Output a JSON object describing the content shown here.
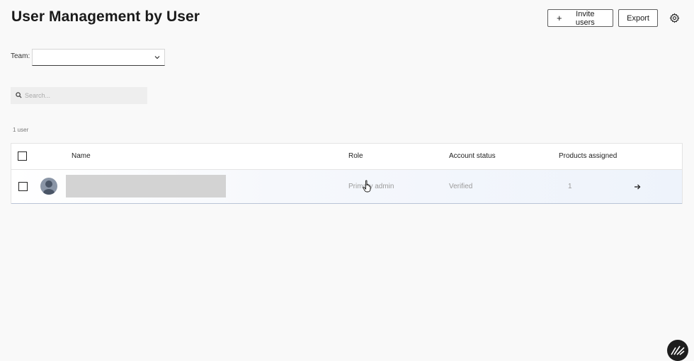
{
  "page": {
    "title": "User Management by User"
  },
  "header": {
    "invite_label": "Invite users",
    "invite_icon": "plus-icon",
    "export_label": "Export",
    "settings_icon": "gear-icon"
  },
  "filters": {
    "team_label": "Team:",
    "team_value": "",
    "search_placeholder": "Search..."
  },
  "summary": {
    "user_count": "1 user"
  },
  "table": {
    "columns": [
      "Name",
      "Role",
      "Account status",
      "Products assigned"
    ],
    "rows": [
      {
        "name": "",
        "role": "Primary admin",
        "status": "Verified",
        "products": "1"
      }
    ]
  },
  "colors": {
    "accent_border": "#b9c4d6",
    "avatar": "#8a95a6",
    "logo_bg": "#1e1e1e"
  }
}
